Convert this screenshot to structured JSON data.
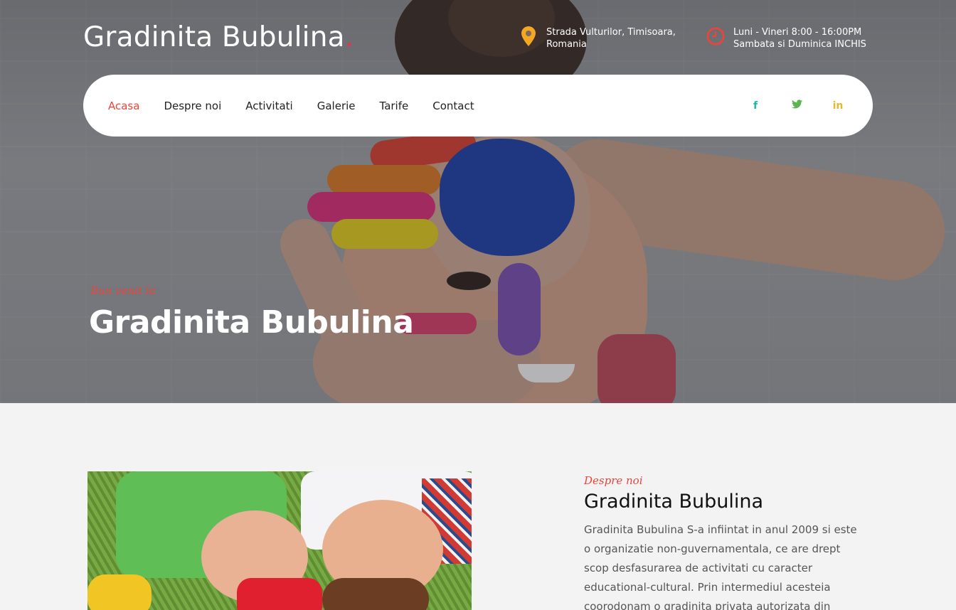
{
  "header": {
    "logo_text": "Gradinita Bubulina",
    "logo_dot": ".",
    "address": {
      "icon": "map-pin-icon",
      "line1": "Strada Vulturilor, Timisoara,",
      "line2": "Romania"
    },
    "hours": {
      "icon": "clock-icon",
      "line1": "Luni - Vineri 8:00 - 16:00PM",
      "line2": "Sambata si Duminica INCHIS"
    }
  },
  "nav": {
    "items": [
      {
        "label": "Acasa",
        "active": true
      },
      {
        "label": "Despre noi"
      },
      {
        "label": "Activitati"
      },
      {
        "label": "Galerie"
      },
      {
        "label": "Tarife"
      },
      {
        "label": "Contact"
      }
    ],
    "socials": [
      {
        "icon": "facebook-icon",
        "glyph": "f",
        "color": "#1fb8a6"
      },
      {
        "icon": "twitter-icon",
        "glyph": "🐦",
        "color": "#5ab552"
      },
      {
        "icon": "linkedin-icon",
        "glyph": "in",
        "color": "#e9b52a"
      }
    ]
  },
  "hero": {
    "kicker": "Bun venit la",
    "title": "Gradinita Bubulina"
  },
  "about": {
    "kicker": "Despre noi",
    "title": "Gradinita Bubulina",
    "text": "Gradinita Bubulina S-a infiintat in anul 2009 si este o organizatie non-guvernamentala, ce are drept scop desfasurarea de activitati cu caracter educational-cultural. Prin intermediul acesteia coorodonam o gradinita privata autorizata din Timisoara si un after"
  },
  "colors": {
    "accent": "#e8463a",
    "pin": "#f5a623",
    "clock": "#e8463a"
  }
}
